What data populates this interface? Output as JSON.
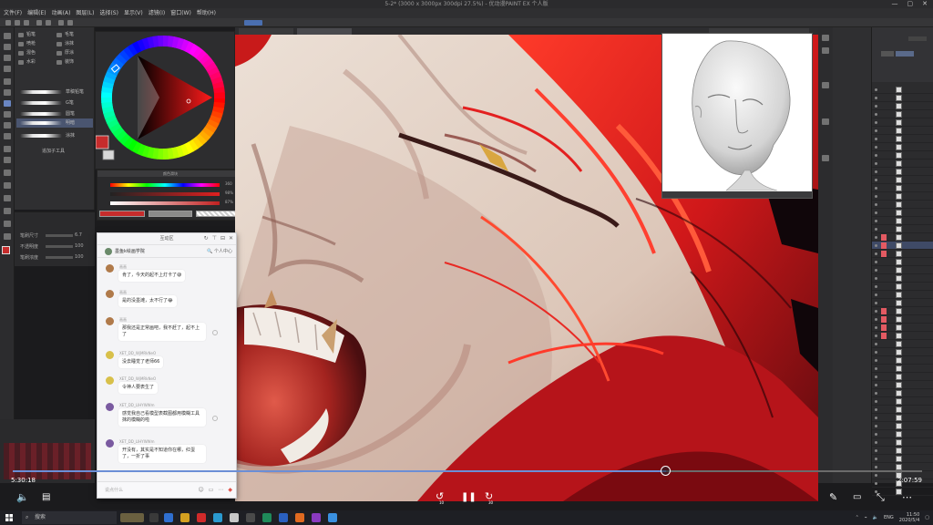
{
  "window": {
    "title": "5-2* (3000 x 3000px 300dpi 27.5%) - 优动漫PAINT EX 个人版",
    "controls": [
      "—",
      "▢",
      "✕"
    ]
  },
  "menu": [
    "文件(F)",
    "编辑(E)",
    "动画(A)",
    "图层(L)",
    "选择(S)",
    "显示(V)",
    "滤镜(I)",
    "窗口(W)",
    "帮助(H)"
  ],
  "subtool": {
    "tabs": [
      "铅笔",
      "毛笔",
      "喷枪",
      "涂抹",
      "混色",
      "厚涂",
      "水彩",
      "装饰"
    ],
    "brushes": [
      {
        "name": "草稿铅笔"
      },
      {
        "name": "G笔"
      },
      {
        "name": "圆笔"
      },
      {
        "name": "明暗"
      },
      {
        "name": "涂抹"
      }
    ],
    "add_label": "追加子工具",
    "props": [
      {
        "label": "笔刷尺寸",
        "value": "6.7"
      },
      {
        "label": "不透明度",
        "value": "100"
      },
      {
        "label": "笔刷浓度",
        "value": "100"
      }
    ]
  },
  "slider_panel": {
    "title": "颜色滑块",
    "values": [
      "360",
      "98%",
      "87%"
    ]
  },
  "chat": {
    "title": "互动区",
    "group_name": "墨鱼k绘画学院",
    "user_center": "个人中心",
    "messages": [
      {
        "name": "画画",
        "text": "肯了，今天的起不上灯卡了😅"
      },
      {
        "name": "画画",
        "text": "是的没墨滩，太不行了😂"
      },
      {
        "name": "画画",
        "text": "那我还是正常画吧，我不赶了，起不上了"
      },
      {
        "name": "XET_DD_WjMRkNeO",
        "text": "没去睡觉了老师66"
      },
      {
        "name": "XET_DD_WjMRkNeO",
        "text": "令神人要表生了"
      },
      {
        "name": "XET_DD_LIHYWWm",
        "text": "感觉我自己看模型表截图都用模糊工具抹的模糊的啦"
      },
      {
        "name": "XET_DD_LIHYWWm",
        "text": "开没有，其实是不知道你在哪，红蛋了，一折了事"
      }
    ],
    "input_placeholder": "说点什么",
    "header_icons": [
      "↻",
      "⊤",
      "⊟",
      "✕"
    ]
  },
  "player": {
    "elapsed": "5:30:18",
    "total": "2:07:59",
    "progress": 0.718,
    "skip_back": "10",
    "skip_forward": "30"
  },
  "taskbar": {
    "search_placeholder": "搜索",
    "clock_time": "11:50",
    "clock_date": "2020/5/4",
    "lang": "ENG"
  },
  "colors": {
    "accent": "#6b8ed6",
    "current_color": "#c62c2c",
    "hair_red": "#d52520",
    "skin": "#e3d0c4"
  }
}
